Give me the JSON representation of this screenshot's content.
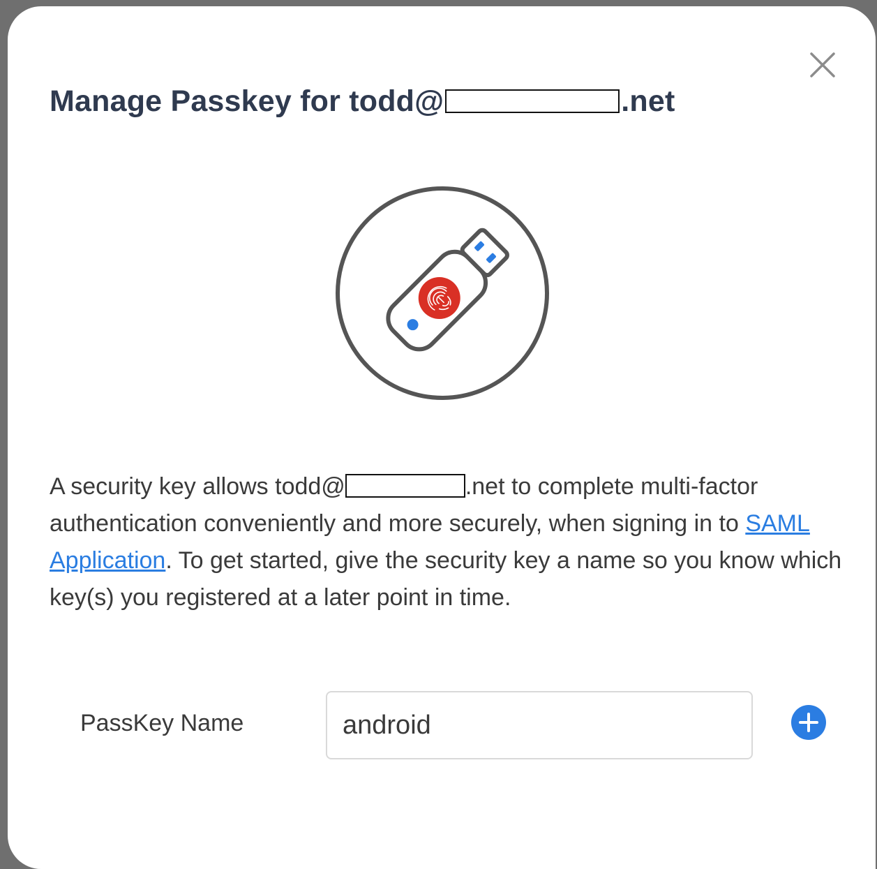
{
  "dialog": {
    "title_prefix": "Manage Passkey for todd@",
    "title_suffix": ".net",
    "close_icon": "close-icon",
    "illustration_icon": "usb-security-key-fingerprint-icon",
    "description": {
      "part1": "A security key allows todd@",
      "part2": ".net to complete multi-factor authentication conveniently and more securely, when signing in to ",
      "link_text": "SAML Application",
      "part3": ". To get started, give the security key a name so you know which key(s) you registered at a later point in time."
    },
    "form": {
      "label": "PassKey Name",
      "input_value": "android",
      "add_icon": "plus-circle-icon"
    }
  },
  "colors": {
    "title": "#2f3a4f",
    "link": "#2a7de1",
    "accent_blue": "#2b7de2",
    "fingerprint_red": "#d93025",
    "outline_gray": "#555555"
  }
}
